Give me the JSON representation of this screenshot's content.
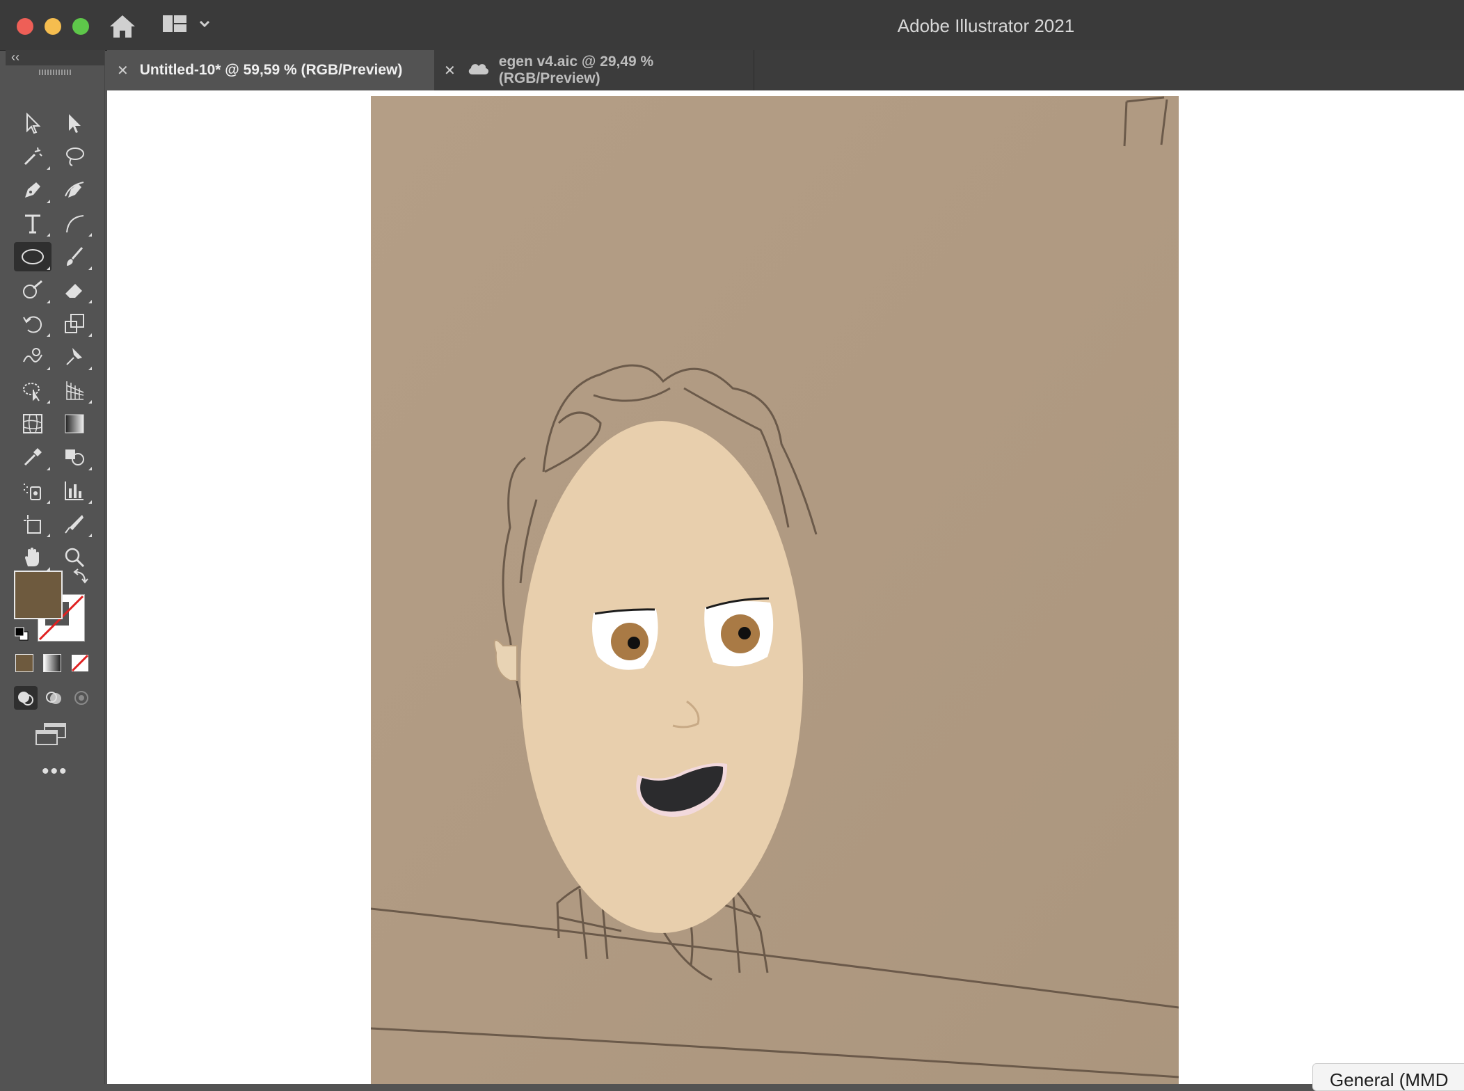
{
  "window": {
    "app_title": "Adobe Illustrator 2021"
  },
  "tabs": [
    {
      "label": "Untitled-10* @ 59,59 % (RGB/Preview)",
      "active": true,
      "close": "✕"
    },
    {
      "label": "egen v4.aic @ 29,49 % (RGB/Preview)",
      "active": false,
      "close": "✕",
      "icon": "cloud-icon"
    }
  ],
  "toolpanel": {
    "collapse": "‹‹",
    "more": "•••",
    "tools": [
      "selection-tool",
      "direct-selection-tool",
      "magic-wand-tool",
      "lasso-tool",
      "pen-tool",
      "curvature-tool",
      "type-tool",
      "line-segment-tool",
      "ellipse-tool",
      "paintbrush-tool",
      "shaper-tool",
      "eraser-tool",
      "rotate-tool",
      "scale-tool",
      "warp-tool",
      "puppet-warp-tool",
      "free-transform-tool",
      "perspective-grid-tool",
      "mesh-tool",
      "gradient-tool",
      "eyedropper-tool",
      "shape-builder-tool",
      "symbol-sprayer-tool",
      "column-graph-tool",
      "artboard-tool",
      "knife-tool",
      "hand-tool",
      "zoom-tool"
    ],
    "active_tool": "ellipse-tool",
    "fill_color": "#6e5a3e",
    "stroke_color": "none"
  },
  "statusbar": {
    "workspace_chip": "General (MMD"
  }
}
